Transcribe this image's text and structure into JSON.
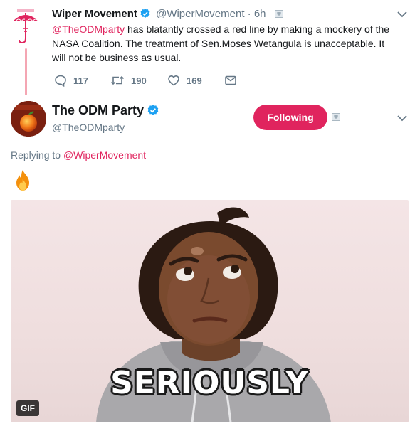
{
  "parent_tweet": {
    "name": "Wiper Movement",
    "handle": "@WiperMovement",
    "separator": "·",
    "time": "6h",
    "text_mention": "@TheODMparty",
    "text_body": " has blatantly crossed a red line by making a mockery of the NASA Coalition. The treatment of Sen.Moses Wetangula is unacceptable. It will not be business as usual.",
    "replies": "117",
    "retweets": "190",
    "likes": "169"
  },
  "main_tweet": {
    "name": "The ODM Party",
    "handle": "@TheODMparty",
    "follow_label": "Following",
    "replying_prefix": "Replying to ",
    "replying_mention": "@WiperMovement",
    "emoji": "fire",
    "media": {
      "caption": "SERIOUSLY",
      "badge": "GIF"
    }
  },
  "colors": {
    "accent": "#e0245e",
    "secondary_text": "#657786",
    "verified": "#1da1f2"
  },
  "icons": [
    "verified-icon",
    "translate-icon",
    "chevron-down-icon",
    "reply-icon",
    "retweet-icon",
    "like-icon",
    "direct-message-icon",
    "fire-emoji"
  ]
}
